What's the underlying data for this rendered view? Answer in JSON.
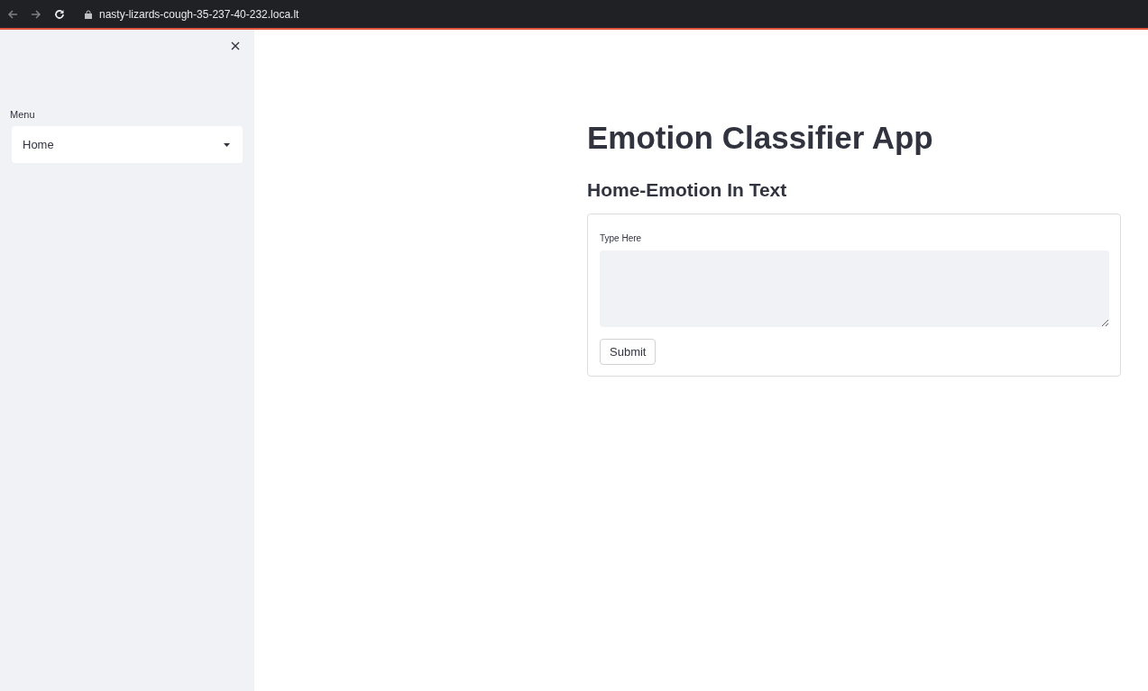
{
  "browser": {
    "url": "nasty-lizards-cough-35-237-40-232.loca.lt"
  },
  "sidebar": {
    "menu_label": "Menu",
    "menu_value": "Home"
  },
  "main": {
    "title": "Emotion Classifier App",
    "subtitle": "Home-Emotion In Text",
    "form": {
      "field_label": "Type Here",
      "submit": "Submit"
    }
  }
}
